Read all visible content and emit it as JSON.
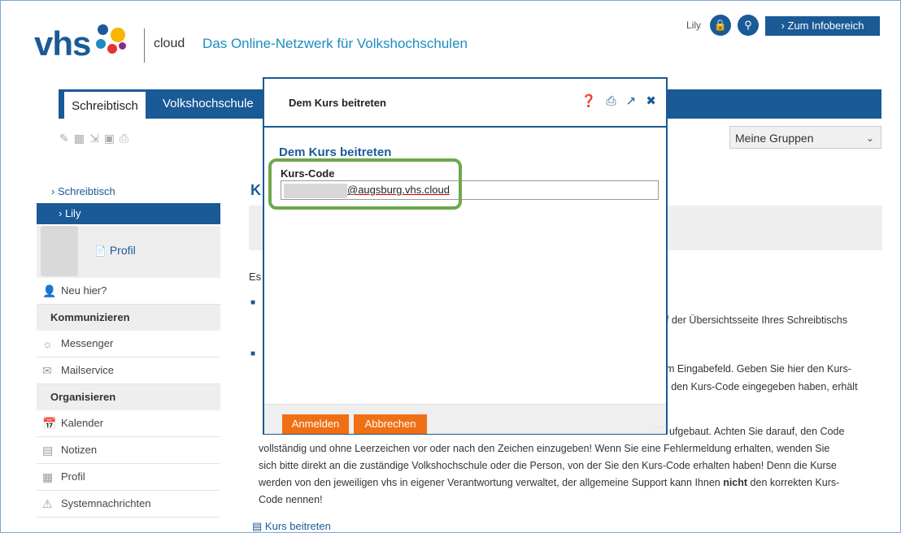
{
  "header": {
    "logo_text": "vhs",
    "cloud_label": "cloud",
    "tagline": "Das Online-Netzwerk für Volkshochschulen",
    "user_name": "Lily",
    "info_button": "› Zum Infobereich"
  },
  "nav": {
    "tab_active": "Schreibtisch",
    "tab_2": "Volkshochschule"
  },
  "toolbar": {
    "select_value": "Meine Gruppen"
  },
  "sidebar": {
    "crumb": "› Schreibtisch",
    "current": "› Lily",
    "profile_link": "Profil",
    "neu_hier": "Neu hier?",
    "section_1": "Kommunizieren",
    "messenger": "Messenger",
    "mailservice": "Mailservice",
    "section_2": "Organisieren",
    "kalender": "Kalender",
    "notizen": "Notizen",
    "profil": "Profil",
    "systemnachrichten": "Systemnachrichten"
  },
  "main": {
    "heading_partial": "K",
    "para_start": "Es",
    "text_1": "uf der Übersichtsseite Ihres Schreibtischs",
    "text_2": "em Eingabefeld. Geben Sie hier den Kurs-",
    "text_3": "ie den Kurs-Code eingegeben haben, erhält",
    "text_4": "ufgebaut. Achten Sie darauf, den Code",
    "text_5": "vollständig und ohne Leerzeichen vor oder nach den Zeichen einzugeben! Wenn Sie eine Fehlermeldung erhalten, wenden Sie",
    "text_6": "sich bitte direkt an die zuständige Volkshochschule oder die Person, von der Sie den Kurs-Code erhalten haben! Denn die Kurse",
    "text_7a": "werden von den jeweiligen vhs in eigener Verantwortung verwaltet, der allgemeine Support kann Ihnen ",
    "text_7b": "nicht",
    "text_7c": " den korrekten Kurs-",
    "text_8": "Code nennen!",
    "link_kurs_beitreten": "Kurs beitreten"
  },
  "modal": {
    "title": "Dem Kurs beitreten",
    "heading": "Dem Kurs beitreten",
    "field_label": "Kurs-Code",
    "field_value_domain": "@augsburg.vhs.cloud",
    "btn_submit": "Anmelden",
    "btn_cancel": "Abbrechen"
  },
  "colors": {
    "brand_blue": "#1a5a96",
    "accent_orange": "#f06f14",
    "highlight_green": "#6ea84a"
  }
}
